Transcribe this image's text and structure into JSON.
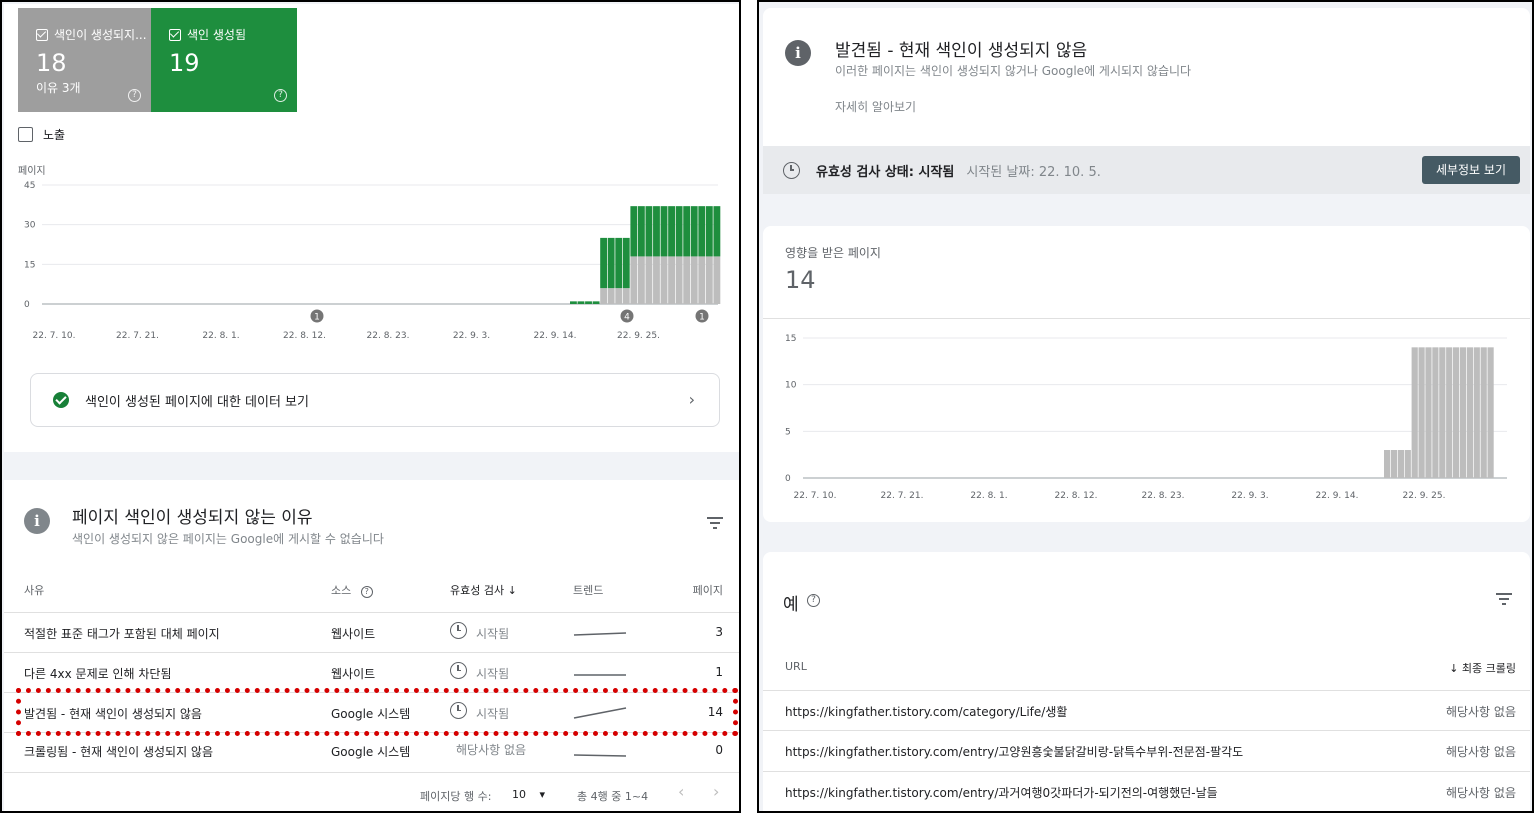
{
  "left": {
    "tiles": [
      {
        "label": "색인이 생성되지...",
        "count": "18",
        "sub": "이유 3개",
        "color": "#9e9e9e"
      },
      {
        "label": "색인 생성됨",
        "count": "19",
        "sub": "",
        "color": "#1e8e3e"
      }
    ],
    "impressions_label": "노출",
    "help_glyph": "?",
    "chart": {
      "ylabel": "페이지",
      "yticks": [
        "45",
        "30",
        "15",
        "0"
      ],
      "xticks": [
        "22. 7. 10.",
        "22. 7. 21.",
        "22. 8. 1.",
        "22. 8. 12.",
        "22. 8. 23.",
        "22. 9. 3.",
        "22. 9. 14.",
        "22. 9. 25."
      ],
      "annotations": [
        "1",
        "4",
        "1"
      ]
    },
    "data_link_label": "색인이 생성된 페이지에 대한 데이터 보기",
    "chevron": "›",
    "reasons": {
      "info_glyph": "i",
      "title": "페이지 색인이 생성되지 않는 이유",
      "subtitle": "색인이 생성되지 않은 페이지는 Google에 게시할 수 없습니다",
      "headers": {
        "reason": "사유",
        "source": "소스",
        "validation": "유효성 검사",
        "trend": "트렌드",
        "pages": "페이지"
      },
      "sort_glyph": "↓",
      "rows": [
        {
          "reason": "적절한 표준 태그가 포함된 대체 페이지",
          "source": "웹사이트",
          "validation": "시작됨",
          "pages": "3"
        },
        {
          "reason": "다른 4xx 문제로 인해 차단됨",
          "source": "웹사이트",
          "validation": "시작됨",
          "pages": "1"
        },
        {
          "reason": "발견됨 - 현재 색인이 생성되지 않음",
          "source": "Google 시스템",
          "validation": "시작됨",
          "pages": "14"
        },
        {
          "reason": "크롤링됨 - 현재 색인이 생성되지 않음",
          "source": "Google 시스템",
          "validation": "해당사항 없음",
          "pages": "0"
        }
      ],
      "pager": {
        "rows_per_page_label": "페이지당 행 수:",
        "rows_per_page": "10",
        "dropdown_glyph": "▾",
        "range": "총 4행 중 1~4",
        "prev_glyph": "‹",
        "next_glyph": "›"
      }
    }
  },
  "right": {
    "info_glyph": "i",
    "title": "발견됨 - 현재 색인이 생성되지 않음",
    "subtitle": "이러한 페이지는 색인이 생성되지 않거나 Google에 게시되지 않습니다",
    "learn_more": "자세히 알아보기",
    "status_label": "유효성 검사 상태: 시작됨",
    "status_date": "시작된 날짜: 22. 10. 5.",
    "details_button": "세부정보 보기",
    "affected_label": "영향을 받은 페이지",
    "affected_count": "14",
    "chart": {
      "yticks": [
        "15",
        "10",
        "5",
        "0"
      ],
      "xticks": [
        "22. 7. 10.",
        "22. 7. 21.",
        "22. 8. 1.",
        "22. 8. 12.",
        "22. 8. 23.",
        "22. 9. 3.",
        "22. 9. 14.",
        "22. 9. 25."
      ]
    },
    "examples_title": "예",
    "help_glyph": "?",
    "url_header": "URL",
    "crawl_header": "↓ 최종 크롤링",
    "urls": [
      {
        "url": "https://kingfather.tistory.com/category/Life/생활",
        "date": "해당사항 없음"
      },
      {
        "url": "https://kingfather.tistory.com/entry/고양원흥숯불닭갈비랑-닭특수부위-전문점-팔각도",
        "date": "해당사항 없음"
      },
      {
        "url": "https://kingfather.tistory.com/entry/과거여행0갓파더가-되기전의-여행했던-날들",
        "date": "해당사항 없음"
      }
    ]
  },
  "chart_data": [
    {
      "type": "bar",
      "title": "",
      "ylabel": "페이지",
      "ylim": [
        0,
        45
      ],
      "xticks": [
        "22. 7. 10.",
        "22. 7. 21.",
        "22. 8. 1.",
        "22. 8. 12.",
        "22. 8. 23.",
        "22. 9. 3.",
        "22. 9. 14.",
        "22. 9. 25."
      ],
      "stacked": true,
      "bar_dates_start": "22. 9. 17.",
      "series": [
        {
          "name": "색인이 생성되지 않음",
          "color": "#bdbdbd",
          "values": [
            0,
            0,
            0,
            0,
            6,
            6,
            6,
            6,
            18,
            18,
            18,
            18,
            18,
            18,
            18,
            18,
            18,
            18,
            18,
            18
          ]
        },
        {
          "name": "색인 생성됨",
          "color": "#1e8e3e",
          "values": [
            1,
            1,
            1,
            1,
            19,
            19,
            19,
            19,
            19,
            19,
            19,
            19,
            19,
            19,
            19,
            19,
            19,
            19,
            19,
            19
          ]
        }
      ]
    },
    {
      "type": "bar",
      "title": "",
      "ylim": [
        0,
        15
      ],
      "xticks": [
        "22. 7. 10.",
        "22. 7. 21.",
        "22. 8. 1.",
        "22. 8. 12.",
        "22. 8. 23.",
        "22. 9. 3.",
        "22. 9. 14.",
        "22. 9. 25."
      ],
      "series": [
        {
          "color": "#bdbdbd",
          "values": [
            3,
            3,
            3,
            3,
            14,
            14,
            14,
            14,
            14,
            14,
            14,
            14,
            14,
            14,
            14,
            14
          ]
        }
      ]
    }
  ]
}
